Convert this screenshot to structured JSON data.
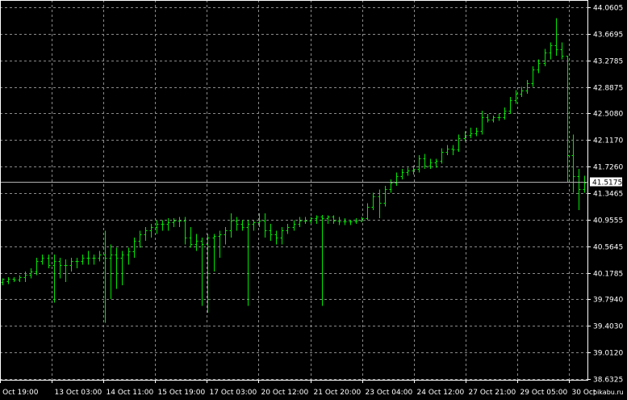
{
  "watermark": "pikabu.ru",
  "colors": {
    "background": "#000000",
    "grid": "#8a8a8a",
    "bars": "#00e600",
    "text": "#ffffff",
    "current_price_line": "#b0b0b0"
  },
  "chart_data": {
    "type": "bar",
    "current_price": "41.5175",
    "grid": true,
    "ylim": [
      38.6325,
      44.0605
    ],
    "y_ticks": [
      "44.0605",
      "43.6695",
      "43.2785",
      "42.8875",
      "42.5080",
      "42.1170",
      "41.7260",
      "41.3465",
      "40.9555",
      "40.5645",
      "40.1785",
      "39.7940",
      "39.4030",
      "39.0120",
      "38.6325"
    ],
    "x_ticks": [
      "9 Oct 19:00",
      "13 Oct 03:00",
      "14 Oct 11:00",
      "15 Oct 19:00",
      "17 Oct 03:00",
      "20 Oct 12:00",
      "21 Oct 20:00",
      "23 Oct 04:00",
      "24 Oct 12:00",
      "27 Oct 21:00",
      "29 Oct 05:00",
      "30 Oct"
    ],
    "x_categories_note": "",
    "series": [
      {
        "values": [
          [
            40.1,
            40.0,
            40.05,
            40.1
          ],
          [
            40.12,
            40.02,
            40.06,
            40.1
          ],
          [
            40.12,
            40.05,
            40.1,
            40.08
          ],
          [
            40.15,
            40.05,
            40.08,
            40.12
          ],
          [
            40.2,
            40.05,
            40.12,
            40.15
          ],
          [
            40.25,
            40.1,
            40.15,
            40.2
          ],
          [
            40.4,
            40.15,
            40.2,
            40.35
          ],
          [
            40.45,
            40.3,
            40.35,
            40.4
          ],
          [
            40.45,
            40.25,
            40.4,
            40.3
          ],
          [
            40.45,
            39.75,
            40.3,
            40.35
          ],
          [
            40.4,
            40.1,
            40.35,
            40.3
          ],
          [
            40.38,
            40.05,
            40.3,
            40.3
          ],
          [
            40.4,
            40.2,
            40.3,
            40.35
          ],
          [
            40.4,
            40.25,
            40.35,
            40.35
          ],
          [
            40.45,
            40.3,
            40.35,
            40.4
          ],
          [
            40.5,
            40.3,
            40.4,
            40.4
          ],
          [
            40.45,
            40.3,
            40.4,
            40.4
          ],
          [
            40.5,
            40.35,
            40.4,
            40.45
          ],
          [
            40.8,
            39.45,
            40.45,
            40.4
          ],
          [
            40.6,
            39.8,
            40.4,
            40.45
          ],
          [
            40.55,
            39.95,
            40.45,
            40.4
          ],
          [
            40.5,
            40.0,
            40.4,
            40.45
          ],
          [
            40.55,
            40.3,
            40.45,
            40.5
          ],
          [
            40.7,
            40.4,
            40.5,
            40.65
          ],
          [
            40.8,
            40.55,
            40.65,
            40.75
          ],
          [
            40.85,
            40.65,
            40.75,
            40.8
          ],
          [
            40.9,
            40.7,
            40.8,
            40.85
          ],
          [
            40.95,
            40.75,
            40.85,
            40.9
          ],
          [
            40.95,
            40.8,
            40.9,
            40.9
          ],
          [
            40.98,
            40.8,
            40.9,
            40.92
          ],
          [
            40.98,
            40.85,
            40.92,
            40.95
          ],
          [
            41.0,
            40.85,
            40.95,
            40.95
          ],
          [
            41.0,
            40.6,
            40.95,
            40.7
          ],
          [
            40.85,
            40.55,
            40.7,
            40.6
          ],
          [
            40.75,
            40.5,
            40.6,
            40.65
          ],
          [
            40.7,
            39.7,
            40.65,
            40.6
          ],
          [
            40.75,
            39.6,
            40.6,
            40.7
          ],
          [
            40.75,
            40.2,
            40.7,
            40.72
          ],
          [
            40.8,
            40.4,
            40.72,
            40.75
          ],
          [
            40.85,
            40.6,
            40.75,
            40.8
          ],
          [
            41.05,
            40.7,
            40.8,
            40.95
          ],
          [
            41.0,
            40.8,
            40.95,
            40.9
          ],
          [
            40.95,
            40.8,
            40.9,
            40.85
          ],
          [
            40.95,
            39.7,
            40.85,
            40.9
          ],
          [
            40.95,
            40.8,
            40.9,
            40.92
          ],
          [
            41.05,
            40.85,
            40.92,
            40.95
          ],
          [
            41.05,
            40.7,
            40.95,
            40.8
          ],
          [
            40.9,
            40.65,
            40.8,
            40.75
          ],
          [
            40.8,
            40.6,
            40.75,
            40.7
          ],
          [
            40.85,
            40.6,
            40.7,
            40.8
          ],
          [
            40.9,
            40.75,
            40.8,
            40.85
          ],
          [
            40.95,
            40.8,
            40.85,
            40.9
          ],
          [
            41.0,
            40.85,
            40.9,
            40.95
          ],
          [
            41.0,
            40.9,
            40.95,
            40.95
          ],
          [
            41.0,
            40.9,
            40.95,
            40.98
          ],
          [
            41.02,
            40.9,
            40.98,
            41.0
          ],
          [
            41.03,
            39.7,
            41.0,
            40.98
          ],
          [
            41.02,
            40.9,
            40.98,
            41.0
          ],
          [
            41.02,
            40.9,
            41.0,
            40.95
          ],
          [
            41.0,
            40.88,
            40.95,
            40.93
          ],
          [
            40.98,
            40.88,
            40.93,
            40.93
          ],
          [
            40.96,
            40.88,
            40.93,
            40.93
          ],
          [
            40.98,
            40.9,
            40.93,
            40.95
          ],
          [
            41.0,
            40.92,
            40.95,
            40.98
          ],
          [
            41.2,
            40.95,
            40.98,
            41.15
          ],
          [
            41.35,
            41.1,
            41.15,
            41.3
          ],
          [
            41.4,
            40.98,
            41.3,
            41.2
          ],
          [
            41.45,
            41.15,
            41.2,
            41.4
          ],
          [
            41.55,
            41.35,
            41.4,
            41.5
          ],
          [
            41.65,
            41.45,
            41.5,
            41.6
          ],
          [
            41.7,
            41.55,
            41.6,
            41.65
          ],
          [
            41.72,
            41.6,
            41.65,
            41.68
          ],
          [
            41.75,
            41.62,
            41.68,
            41.7
          ],
          [
            41.9,
            41.65,
            41.7,
            41.85
          ],
          [
            41.92,
            41.7,
            41.85,
            41.75
          ],
          [
            41.85,
            41.7,
            41.75,
            41.8
          ],
          [
            41.85,
            41.72,
            41.8,
            41.82
          ],
          [
            42.0,
            41.78,
            41.82,
            41.95
          ],
          [
            42.05,
            41.9,
            41.95,
            42.0
          ],
          [
            42.05,
            41.9,
            42.0,
            41.98
          ],
          [
            42.2,
            41.95,
            41.98,
            42.15
          ],
          [
            42.25,
            42.1,
            42.15,
            42.2
          ],
          [
            42.3,
            42.15,
            42.2,
            42.22
          ],
          [
            42.3,
            42.18,
            42.22,
            42.25
          ],
          [
            42.55,
            42.2,
            42.25,
            42.45
          ],
          [
            42.5,
            42.38,
            42.45,
            42.42
          ],
          [
            42.48,
            42.38,
            42.42,
            42.45
          ],
          [
            42.5,
            42.4,
            42.45,
            42.45
          ],
          [
            42.6,
            42.42,
            42.45,
            42.55
          ],
          [
            42.75,
            42.5,
            42.55,
            42.7
          ],
          [
            42.85,
            42.65,
            42.7,
            42.8
          ],
          [
            42.9,
            42.75,
            42.8,
            42.85
          ],
          [
            43.0,
            42.8,
            42.85,
            42.95
          ],
          [
            43.2,
            42.9,
            42.95,
            43.15
          ],
          [
            43.3,
            43.1,
            43.15,
            43.25
          ],
          [
            43.45,
            43.2,
            43.25,
            43.4
          ],
          [
            43.55,
            43.3,
            43.4,
            43.5
          ],
          [
            43.9,
            43.35,
            43.5,
            43.45
          ],
          [
            43.55,
            43.3,
            43.45,
            43.35
          ],
          [
            43.35,
            41.5,
            43.35,
            41.9
          ],
          [
            42.2,
            41.35,
            41.9,
            41.6
          ],
          [
            41.7,
            41.1,
            41.6,
            41.4
          ],
          [
            41.6,
            41.35,
            41.4,
            41.5
          ]
        ]
      }
    ]
  }
}
